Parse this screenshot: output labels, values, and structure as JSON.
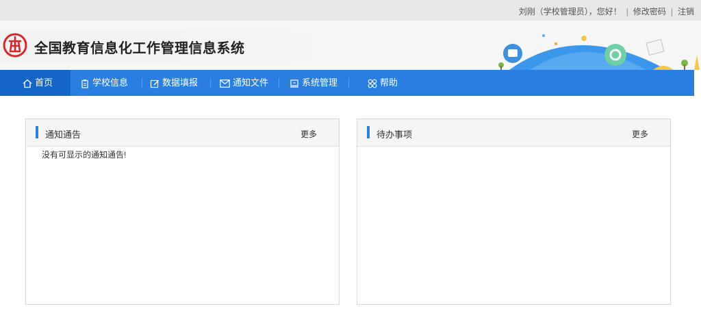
{
  "topbar": {
    "user_greeting": "刘刚（学校管理员），您好！",
    "sep1": "|",
    "change_password": "修改密码",
    "sep2": "|",
    "logout": "注销"
  },
  "header": {
    "system_title": "全国教育信息化工作管理信息系统",
    "logo_icon": "education-seal-icon"
  },
  "nav": {
    "items": [
      {
        "label": "首页",
        "icon": "home-icon",
        "active": true
      },
      {
        "label": "学校信息",
        "icon": "clipboard-icon"
      },
      {
        "label": "数据填报",
        "icon": "edit-icon"
      },
      {
        "label": "通知文件",
        "icon": "mail-icon"
      },
      {
        "label": "系统管理",
        "icon": "monitor-icon"
      },
      {
        "label": "帮助",
        "icon": "grid-icon"
      }
    ]
  },
  "panels": {
    "notices": {
      "title": "通知通告",
      "more": "更多",
      "empty_text": "没有可显示的通知通告!"
    },
    "todos": {
      "title": "待办事项",
      "more": "更多"
    }
  },
  "colors": {
    "nav_bg": "#2a7de1",
    "nav_active": "#1565c8",
    "accent_bar": "#2a7de1",
    "logo_red": "#d9262b"
  }
}
